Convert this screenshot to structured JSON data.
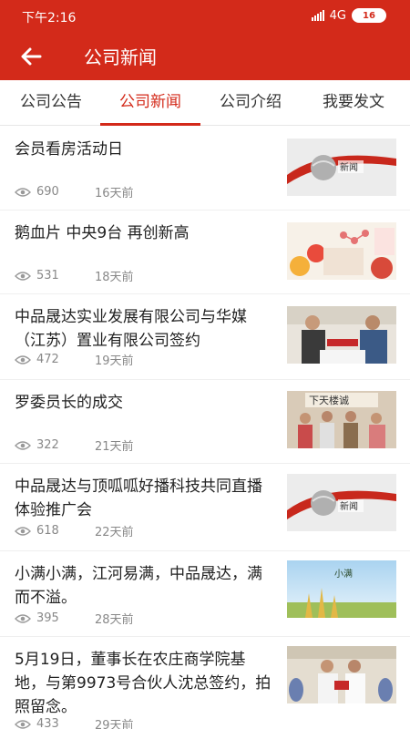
{
  "status": {
    "time": "下午2:16",
    "network": "4G",
    "battery": "16"
  },
  "header": {
    "title": "公司新闻"
  },
  "tabs": [
    {
      "label": "公司公告"
    },
    {
      "label": "公司新闻"
    },
    {
      "label": "公司介绍"
    },
    {
      "label": "我要发文"
    }
  ],
  "news": [
    {
      "title": "会员看房活动日",
      "views": "690",
      "time": "16天前",
      "thumb_label": "新闻"
    },
    {
      "title": "鹅血片 中央9台 再创新高",
      "views": "531",
      "time": "18天前"
    },
    {
      "title": "中品晟达实业发展有限公司与华媒（江苏）置业有限公司签约",
      "views": "472",
      "time": "19天前"
    },
    {
      "title": "罗委员长的成交",
      "views": "322",
      "time": "21天前",
      "thumb_label": "下天楼诚"
    },
    {
      "title": "中品晟达与顶呱呱好播科技共同直播体验推广会",
      "views": "618",
      "time": "22天前",
      "thumb_label": "新闻"
    },
    {
      "title": "小满小满，江河易满，中品晟达，满而不溢。",
      "views": "395",
      "time": "28天前",
      "thumb_label": "小满"
    },
    {
      "title": "5月19日，董事长在农庄商学院基地，与第9973号合伙人沈总签约，拍照留念。",
      "views": "433",
      "time": "29天前"
    }
  ]
}
